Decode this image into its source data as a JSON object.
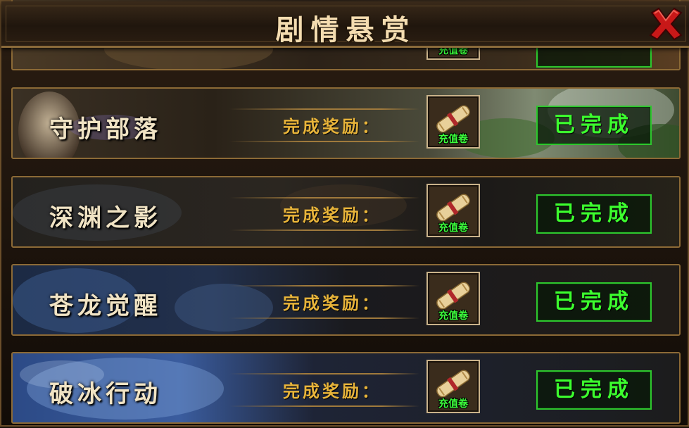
{
  "window": {
    "title": "剧情悬赏"
  },
  "tasks": [
    {
      "name": "",
      "reward_label": "",
      "item_name": "充值卷",
      "status": ""
    },
    {
      "name": "守护部落",
      "reward_label": "完成奖励：",
      "item_name": "充值卷",
      "status": "已完成"
    },
    {
      "name": "深渊之影",
      "reward_label": "完成奖励：",
      "item_name": "充值卷",
      "status": "已完成"
    },
    {
      "name": "苍龙觉醒",
      "reward_label": "完成奖励：",
      "item_name": "充值卷",
      "status": "已完成"
    },
    {
      "name": "破冰行动",
      "reward_label": "完成奖励：",
      "item_name": "充值卷",
      "status": "已完成"
    }
  ],
  "colors": {
    "title_text": "#f4dcb0",
    "reward_label": "#e8b43a",
    "status_text": "#3cff2e",
    "item_name": "#3cff3c",
    "frame_gold": "#8c6a36"
  },
  "icons": {
    "close": "close-x-icon",
    "reward_item": "scroll-icon"
  }
}
